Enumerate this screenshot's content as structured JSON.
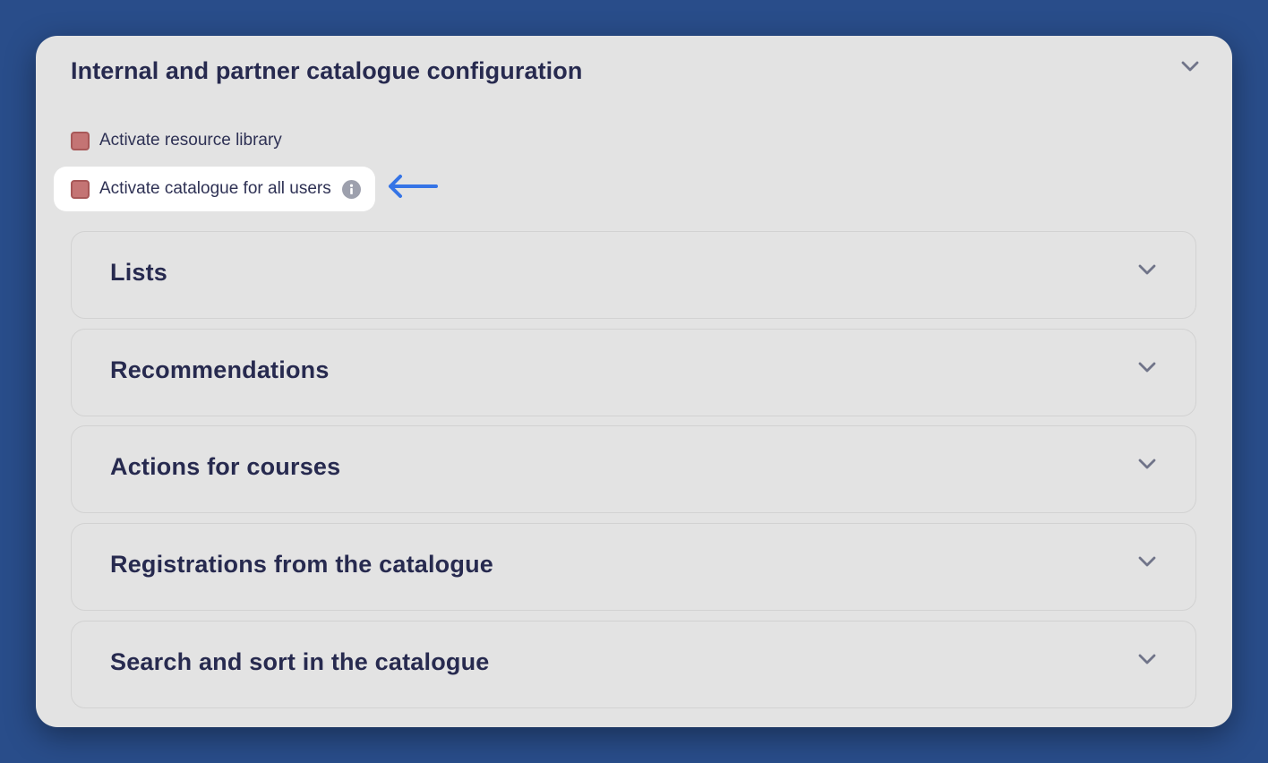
{
  "panel": {
    "title": "Internal and partner catalogue configuration",
    "chevron_icon": "chevron-down-icon"
  },
  "checkboxes": [
    {
      "label": "Activate resource library",
      "checked": false
    },
    {
      "label": "Activate catalogue for all users",
      "checked": false,
      "has_info_icon": true,
      "highlighted": true
    }
  ],
  "annotation": {
    "arrow_icon": "arrow-left-icon",
    "arrow_color": "#3574e6"
  },
  "sections": [
    {
      "title": "Lists"
    },
    {
      "title": "Recommendations"
    },
    {
      "title": "Actions for courses"
    },
    {
      "title": "Registrations from the catalogue"
    },
    {
      "title": "Search and sort in the catalogue"
    }
  ],
  "colors": {
    "background": "#294d8a",
    "panel": "#e3e3e3",
    "title_text": "#272a4f",
    "checkbox_fill": "#c47474"
  }
}
